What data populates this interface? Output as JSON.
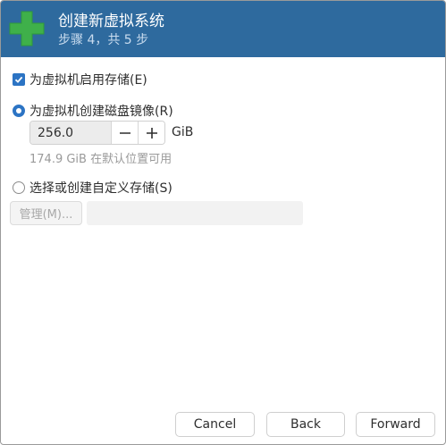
{
  "header": {
    "title": "创建新虚拟系统",
    "subtitle": "步骤 4，共 5 步",
    "icon": "plus-icon",
    "background": "#2e6a9e"
  },
  "storage": {
    "enable_label": "为虚拟机启用存储(E)",
    "enable_checked": true,
    "create_disk_label": "为虚拟机创建磁盘镜像(R)",
    "create_disk_selected": true,
    "disk_size": "256.0",
    "disk_unit": "GiB",
    "available_hint": "174.9 GiB 在默认位置可用",
    "custom_label": "选择或创建自定义存储(S)",
    "custom_selected": false,
    "manage_label": "管理(M)...",
    "custom_path": ""
  },
  "footer": {
    "cancel_label": "Cancel",
    "back_label": "Back",
    "forward_label": "Forward"
  },
  "colors": {
    "accent": "#2c74c4",
    "icon_green": "#3fb04a"
  }
}
